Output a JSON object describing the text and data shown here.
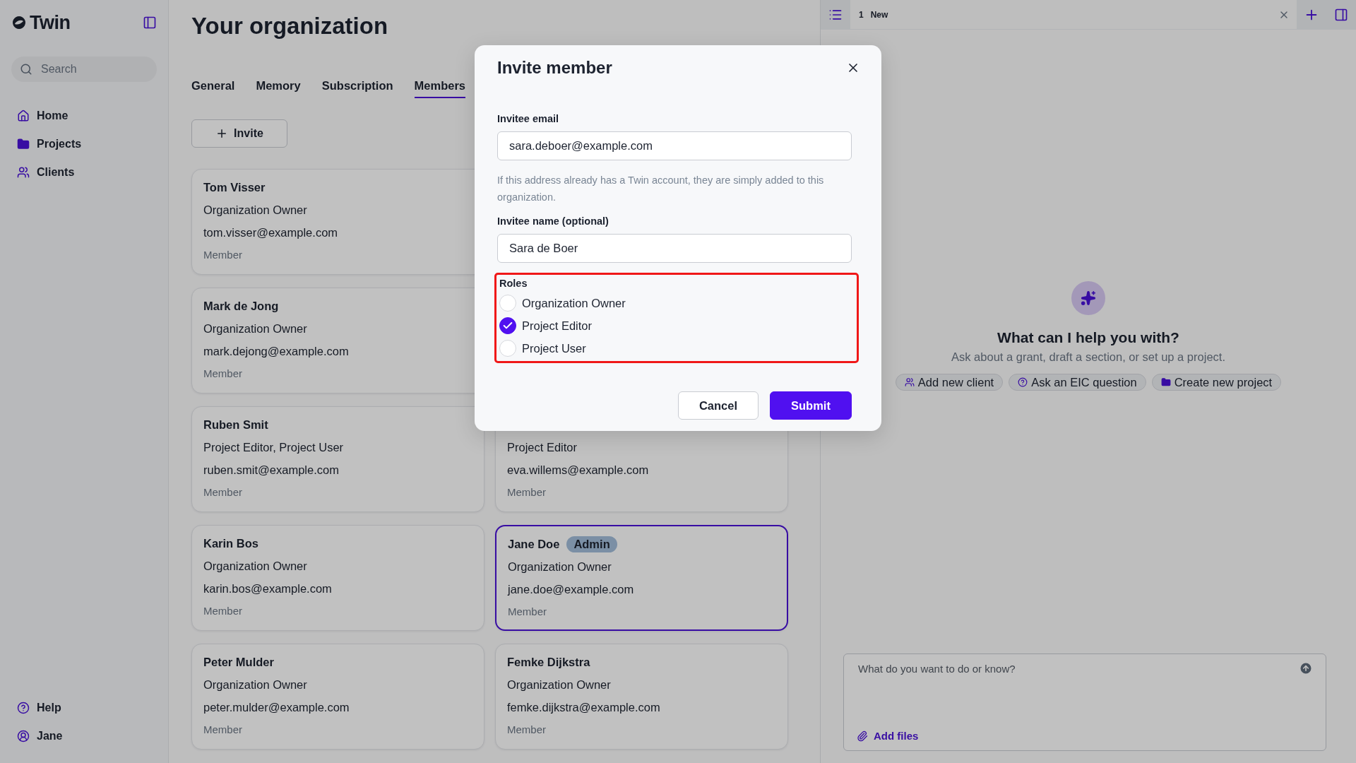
{
  "sidebar": {
    "logo": "Twin",
    "search": {
      "placeholder": "Search"
    },
    "nav": [
      {
        "label": "Home",
        "kind": "home"
      },
      {
        "label": "Projects",
        "kind": "folder"
      },
      {
        "label": "Clients",
        "kind": "users"
      }
    ],
    "footer": [
      {
        "label": "Help",
        "kind": "help"
      },
      {
        "label": "Jane",
        "kind": "user"
      }
    ]
  },
  "main": {
    "title": "Your organization",
    "tabs": [
      {
        "label": "General",
        "selected": false
      },
      {
        "label": "Memory",
        "selected": false
      },
      {
        "label": "Subscription",
        "selected": false
      },
      {
        "label": "Members",
        "selected": true
      }
    ],
    "invite_button": "Invite",
    "members_left": [
      {
        "name": "Tom Visser",
        "role": "Organization Owner",
        "email": "tom.visser@example.com",
        "status": "Member",
        "highlighted": false
      },
      {
        "name": "Mark de Jong",
        "role": "Organization Owner",
        "email": "mark.dejong@example.com",
        "status": "Member",
        "highlighted": false
      },
      {
        "name": "Ruben Smit",
        "role": "Project Editor, Project User",
        "email": "ruben.smit@example.com",
        "status": "Member",
        "highlighted": false
      },
      {
        "name": "Karin Bos",
        "role": "Organization Owner",
        "email": "karin.bos@example.com",
        "status": "Member",
        "highlighted": false
      },
      {
        "name": "Peter Mulder",
        "role": "Organization Owner",
        "email": "peter.mulder@example.com",
        "status": "Member",
        "highlighted": false
      }
    ],
    "members_right": [
      {
        "role": "Project Editor",
        "email": "eva.willems@example.com",
        "status": "Member",
        "highlighted": false
      },
      {
        "name": "Jane Doe",
        "badge": "Admin",
        "role": "Organization Owner",
        "email": "jane.doe@example.com",
        "status": "Member",
        "highlighted": true
      },
      {
        "name": "Femke Dijkstra",
        "role": "Organization Owner",
        "email": "femke.dijkstra@example.com",
        "status": "Member",
        "highlighted": false
      }
    ]
  },
  "assistant": {
    "tab": {
      "number": "1",
      "label": "New"
    },
    "heading": "What can I help you with?",
    "subtitle": "Ask about a grant, draft a section, or set up a project.",
    "suggestions": [
      {
        "label": "Add new client",
        "kind": "users"
      },
      {
        "label": "Ask an EIC question",
        "kind": "help"
      },
      {
        "label": "Create new project",
        "kind": "folder"
      }
    ],
    "chat": {
      "placeholder": "What do you want to do or know?",
      "add_files": "Add files"
    }
  },
  "dialog": {
    "title": "Invite member",
    "email": {
      "label": "Invitee email",
      "value": "sara.deboer@example.com"
    },
    "hint": "If this address already has a Twin account, they are simply added to this organization.",
    "name": {
      "label": "Invitee name (optional)",
      "value": "Sara de Boer"
    },
    "roles": {
      "label": "Roles",
      "highlighted": true,
      "options": [
        {
          "label": "Organization Owner",
          "checked": false
        },
        {
          "label": "Project Editor",
          "checked": true
        },
        {
          "label": "Project User",
          "checked": false
        }
      ]
    },
    "buttons": [
      {
        "label": "Cancel",
        "kind": "secondary"
      },
      {
        "label": "Submit",
        "kind": "primary"
      }
    ]
  }
}
